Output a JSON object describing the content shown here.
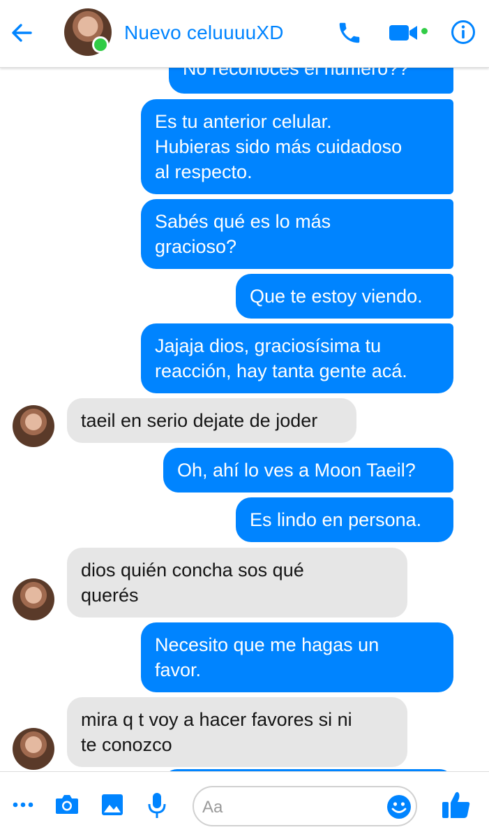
{
  "header": {
    "contact_name": "Nuevo celuuuuXD",
    "icons": [
      "back-arrow-icon",
      "phone-icon",
      "video-camera-icon",
      "info-icon"
    ]
  },
  "messages": [
    {
      "from": "me",
      "text": "No reconoces el número??"
    },
    {
      "from": "me",
      "text": "Es tu anterior celular.\nHubieras sido más cuidadoso\nal respecto."
    },
    {
      "from": "me",
      "text": "Sabés qué es lo más\ngracioso?"
    },
    {
      "from": "me",
      "text": "Que te estoy viendo."
    },
    {
      "from": "me",
      "text": "Jajaja dios, graciosísima tu\nreacción, hay tanta gente acá."
    },
    {
      "from": "them",
      "text": "taeil en serio dejate de joder"
    },
    {
      "from": "me",
      "text": "Oh, ahí lo ves a Moon Taeil?"
    },
    {
      "from": "me",
      "text": "Es lindo en persona."
    },
    {
      "from": "them",
      "text": "dios quién concha sos qué\nquerés"
    },
    {
      "from": "me",
      "text": "Necesito que me hagas un\nfavor."
    },
    {
      "from": "them",
      "text": "mira q t voy a hacer favores si ni\nte conozco"
    }
  ],
  "composer": {
    "placeholder": "Aa",
    "icons": [
      "more-icon",
      "camera-icon",
      "image-icon",
      "microphone-icon",
      "emoji-icon",
      "like-thumb-icon"
    ]
  },
  "colors": {
    "accent": "#0084ff",
    "sent_bubble": "#0084ff",
    "received_bubble": "#e6e6e6",
    "online": "#31cc46"
  }
}
